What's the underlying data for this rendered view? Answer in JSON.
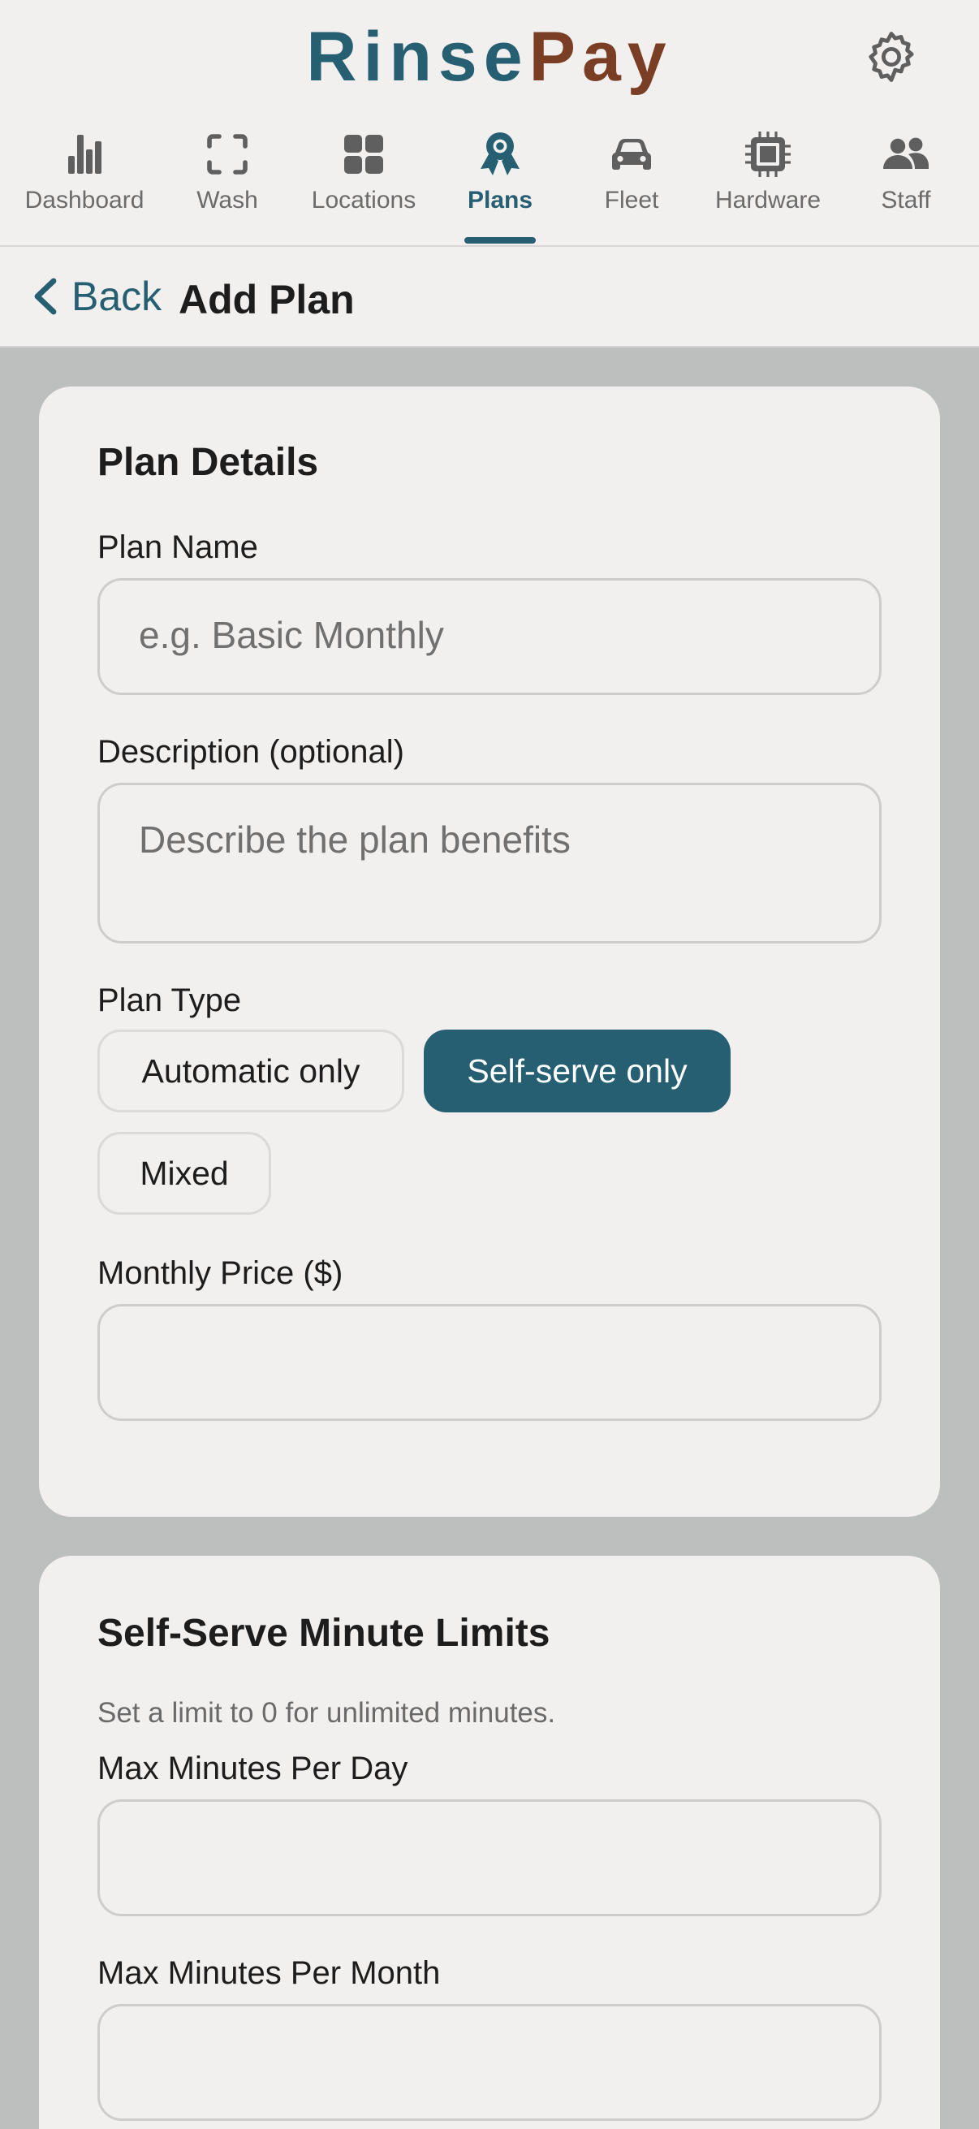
{
  "brand": {
    "part1": "Rinse",
    "part2": "Pay",
    "color1": "#265e72",
    "color2": "#7a3e24"
  },
  "header": {
    "settings_icon": "gear-icon"
  },
  "nav": {
    "items": [
      {
        "label": "Dashboard",
        "icon": "bar-chart-icon"
      },
      {
        "label": "Wash",
        "icon": "scan-frame-icon"
      },
      {
        "label": "Locations",
        "icon": "grid-icon"
      },
      {
        "label": "Plans",
        "icon": "award-icon",
        "active": true
      },
      {
        "label": "Fleet",
        "icon": "car-icon"
      },
      {
        "label": "Hardware",
        "icon": "chip-icon"
      },
      {
        "label": "Staff",
        "icon": "users-icon"
      }
    ],
    "active_color": "#265e72"
  },
  "subheader": {
    "back_label": "Back",
    "title": "Add Plan"
  },
  "plan_details": {
    "heading": "Plan Details",
    "name_label": "Plan Name",
    "name_placeholder": "e.g. Basic Monthly",
    "name_value": "",
    "description_label": "Description (optional)",
    "description_placeholder": "Describe the plan benefits",
    "description_value": "",
    "type_label": "Plan Type",
    "type_options": [
      "Automatic only",
      "Self-serve only",
      "Mixed"
    ],
    "type_selected": "Self-serve only",
    "price_label": "Monthly Price ($)",
    "price_value": ""
  },
  "minute_limits": {
    "heading": "Self-Serve Minute Limits",
    "hint": "Set a limit to 0 for unlimited minutes.",
    "per_day_label": "Max Minutes Per Day",
    "per_day_value": "",
    "per_month_label": "Max Minutes Per Month",
    "per_month_value": ""
  }
}
